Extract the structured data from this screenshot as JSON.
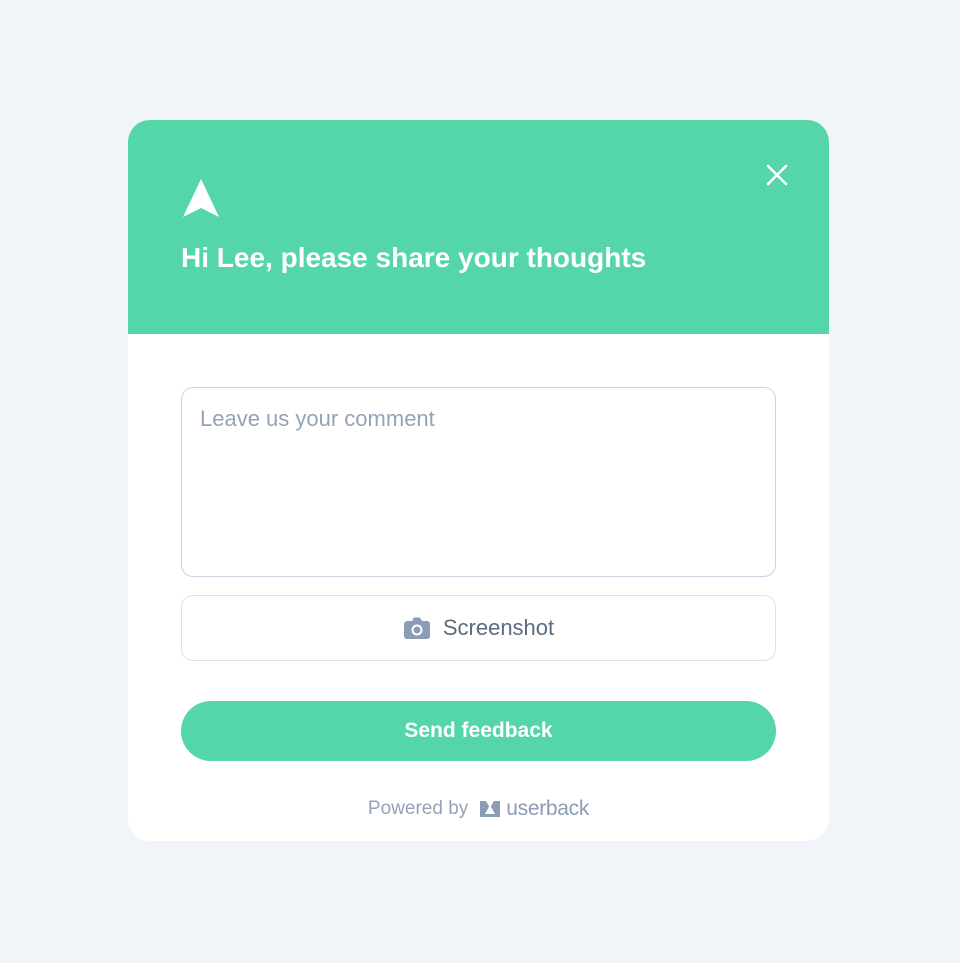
{
  "widget": {
    "title": "Hi Lee, please share your thoughts",
    "logo_icon": "arrow-up-icon",
    "close_icon": "close-icon",
    "accent_color": "#54d6a9",
    "comment": {
      "value": "",
      "placeholder": "Leave us your comment"
    },
    "screenshot": {
      "label": "Screenshot",
      "icon": "camera-icon"
    },
    "send": {
      "label": "Send feedback"
    },
    "footer": {
      "powered_by": "Powered by",
      "brand": "userback",
      "brand_icon": "userback-logo-icon"
    }
  }
}
